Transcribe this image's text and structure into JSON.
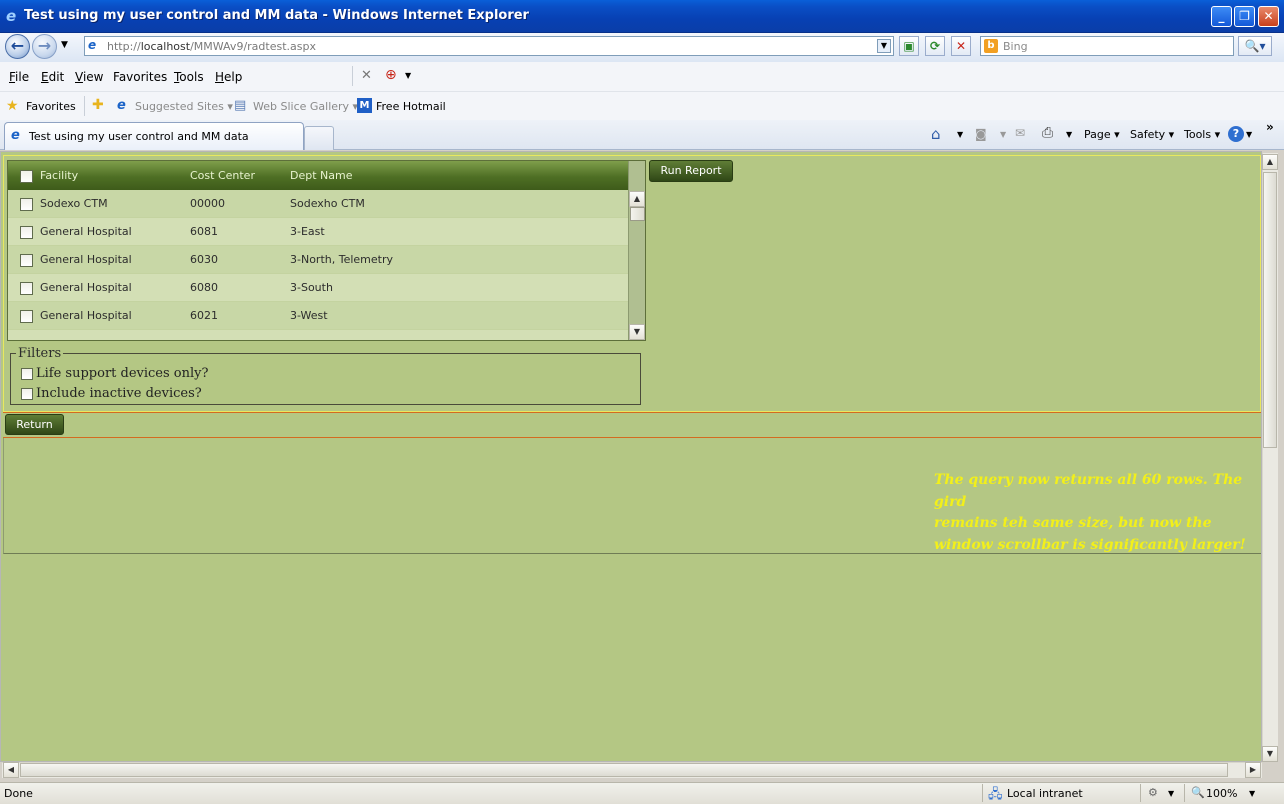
{
  "window": {
    "title": "Test using my user control and MM data - Windows Internet Explorer",
    "controls": {
      "minimize": "_",
      "maximize": "❐",
      "close": "✕"
    }
  },
  "address_bar": {
    "url_prefix": "http://",
    "url_host": "localhost",
    "url_path": "/MMWAv9/radtest.aspx",
    "search_placeholder": "Bing"
  },
  "menu": {
    "items": [
      {
        "key": "F",
        "rest": "ile"
      },
      {
        "key": "E",
        "rest": "dit"
      },
      {
        "key": "V",
        "rest": "iew"
      },
      {
        "key": "F",
        "rest": "avorites",
        "prefix": ""
      },
      {
        "key": "T",
        "rest": "ools"
      },
      {
        "key": "H",
        "rest": "elp"
      }
    ]
  },
  "favorites_bar": {
    "favorites": "Favorites",
    "suggested_sites": "Suggested Sites ▾",
    "web_slice_gallery": "Web Slice Gallery ▾",
    "free_hotmail": "Free Hotmail"
  },
  "tab": {
    "title": "Test using my user control and MM data"
  },
  "command_bar": {
    "page": "Page ▾",
    "safety": "Safety ▾",
    "tools": "Tools ▾",
    "help": "?",
    "more": "»"
  },
  "grid": {
    "columns": [
      "Facility",
      "Cost Center",
      "Dept Name"
    ],
    "rows": [
      {
        "facility": "Sodexo CTM",
        "cost_center": "00000",
        "dept_name": "Sodexho CTM"
      },
      {
        "facility": "General Hospital",
        "cost_center": "6081",
        "dept_name": "3-East"
      },
      {
        "facility": "General Hospital",
        "cost_center": "6030",
        "dept_name": "3-North, Telemetry"
      },
      {
        "facility": "General Hospital",
        "cost_center": "6080",
        "dept_name": "3-South"
      },
      {
        "facility": "General Hospital",
        "cost_center": "6021",
        "dept_name": "3-West"
      }
    ],
    "colors": {
      "header": "#4e6f24",
      "row_alt": "#c8d7a6",
      "row": "#d3dfb5"
    }
  },
  "buttons": {
    "run_report": "Run Report",
    "return": "Return"
  },
  "filters": {
    "legend": "Filters",
    "life_support": "Life support devices only?",
    "include_inactive": "Include inactive devices?"
  },
  "note": {
    "line1": "The query now returns all 60 rows. The gird",
    "line2": "remains teh same size, but now the",
    "line3": "window scrollbar is significantly larger!",
    "color": "#f3f019"
  },
  "status_bar": {
    "status": "Done",
    "zone": "Local intranet",
    "zoom": "100%"
  },
  "theme": {
    "page_background": "#b4c784",
    "accent_border": "#d36b20"
  }
}
